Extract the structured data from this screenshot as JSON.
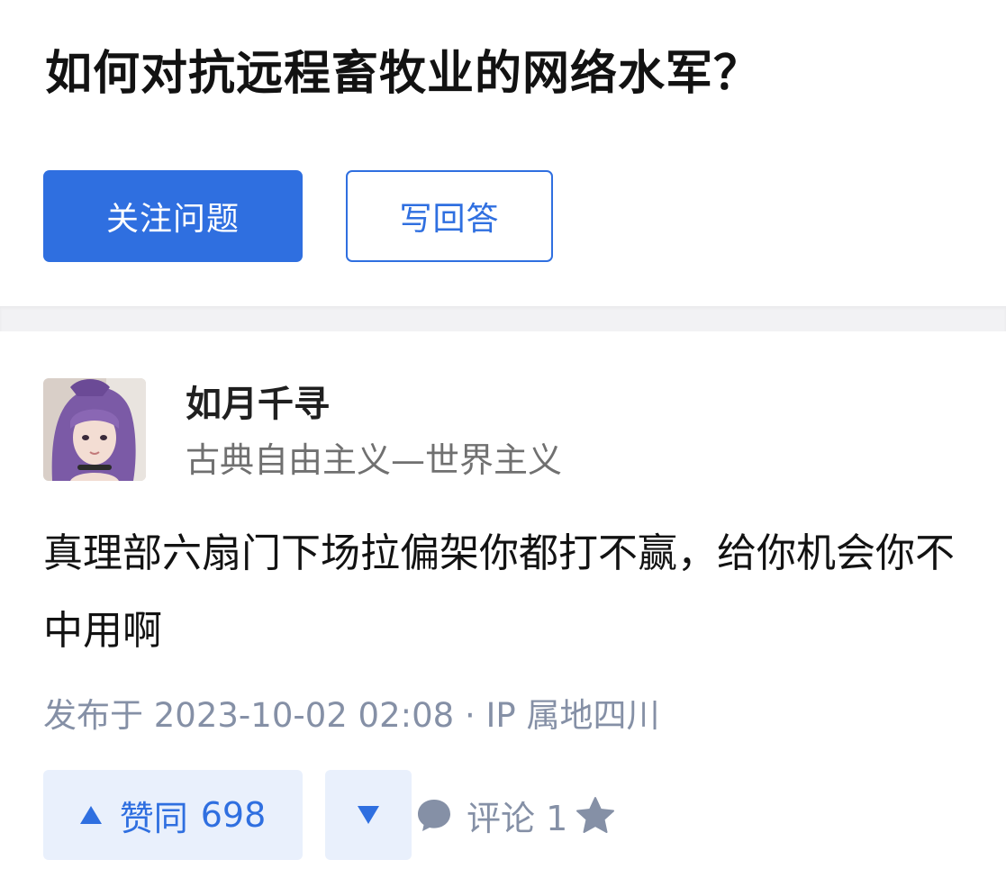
{
  "question": {
    "title": "如何对抗远程畜牧业的网络水军？",
    "follow_label": "关注问题",
    "answer_label": "写回答"
  },
  "answer": {
    "author": {
      "name": "如月千寻",
      "headline": "古典自由主义—世界主义",
      "avatar_icon": "avatar-photo"
    },
    "content": "真理部六扇门下场拉偏架你都打不赢，给你机会你不中用啊",
    "meta": "发布于 2023-10-02 02:08 · IP 属地四川",
    "actions": {
      "upvote_label": "赞同",
      "upvote_count": "698",
      "downvote_icon": "triangle-down-icon",
      "comment_label": "评论 1",
      "comment_icon": "speech-bubble-icon",
      "favorite_icon": "star-icon"
    }
  },
  "colors": {
    "accent": "#2f6fe0",
    "accent_light": "#e9f0fc",
    "muted": "#8590a6",
    "divider": "#f2f2f4"
  }
}
